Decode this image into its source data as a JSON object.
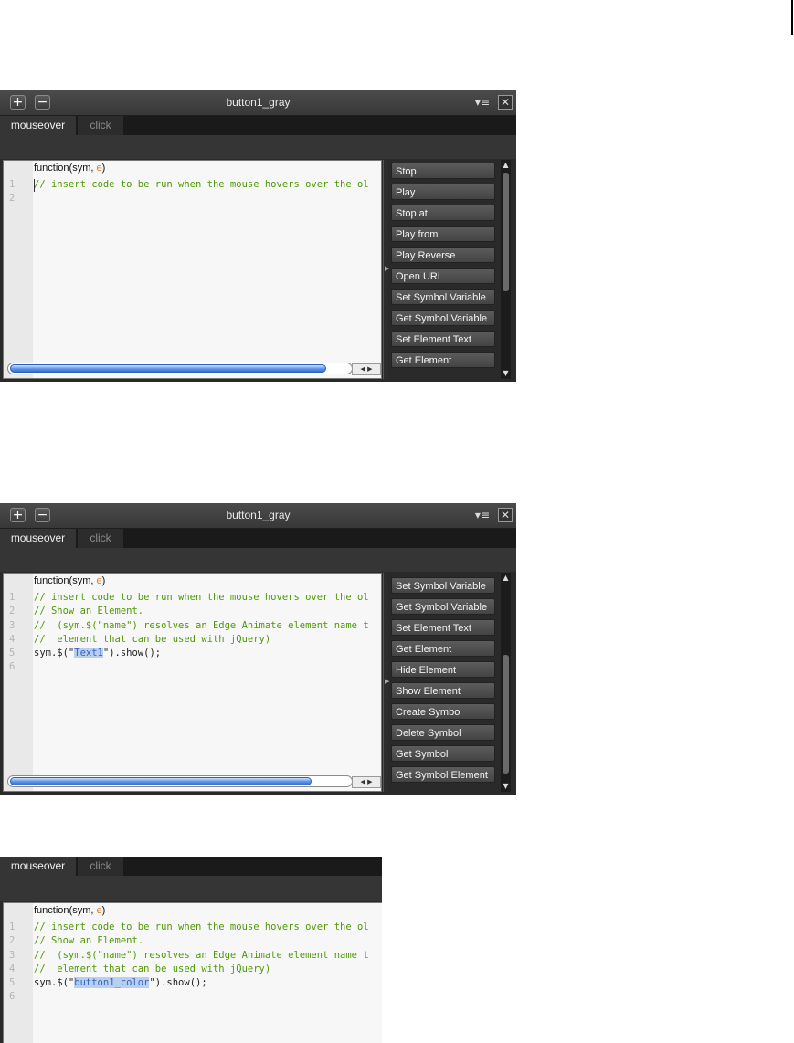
{
  "panel_title": "button1_gray",
  "icons": {
    "add": "+",
    "remove": "−",
    "menu": "▾≡",
    "close": "✕",
    "left": "◀",
    "right": "▶",
    "up": "▲",
    "down": "▼"
  },
  "tabs": {
    "active": "mouseover",
    "inactive": "click"
  },
  "function_header": {
    "text": "function(sym, ",
    "param": "e",
    "close": ")"
  },
  "panels": [
    {
      "lines": [
        {
          "num": "1",
          "parts": [
            {
              "text": "// insert code to be run when the mouse hovers over the ol",
              "style": "comment"
            }
          ]
        },
        {
          "num": "2",
          "parts": []
        }
      ],
      "snippets": [
        "Stop",
        "Play",
        "Stop at",
        "Play from",
        "Play Reverse",
        "Open URL",
        "Set Symbol Variable",
        "Get Symbol Variable",
        "Set Element Text",
        "Get Element"
      ]
    },
    {
      "lines": [
        {
          "num": "1",
          "parts": [
            {
              "text": "// insert code to be run when the mouse hovers over the ol",
              "style": "comment"
            }
          ]
        },
        {
          "num": "2",
          "parts": [
            {
              "text": "// Show an Element.",
              "style": "comment"
            }
          ]
        },
        {
          "num": "3",
          "parts": [
            {
              "text": "//  (sym.$(\"name\") resolves an Edge Animate element name t",
              "style": "comment"
            }
          ]
        },
        {
          "num": "4",
          "parts": [
            {
              "text": "//  element that can be used with jQuery)",
              "style": "comment"
            }
          ]
        },
        {
          "num": "5",
          "parts": [
            {
              "text": "sym.$(\"",
              "style": "plain"
            },
            {
              "text": "Text1",
              "style": "sel"
            },
            {
              "text": "\").show();",
              "style": "plain"
            }
          ]
        },
        {
          "num": "6",
          "parts": []
        }
      ],
      "snippets": [
        "Set Symbol Variable",
        "Get Symbol Variable",
        "Set Element Text",
        "Get Element",
        "Hide Element",
        "Show Element",
        "Create Symbol",
        "Delete Symbol",
        "Get Symbol",
        "Get Symbol Element"
      ]
    },
    {
      "lines": [
        {
          "num": "1",
          "parts": [
            {
              "text": "// insert code to be run when the mouse hovers over the ol",
              "style": "comment"
            }
          ]
        },
        {
          "num": "2",
          "parts": [
            {
              "text": "// Show an Element.",
              "style": "comment"
            }
          ]
        },
        {
          "num": "3",
          "parts": [
            {
              "text": "//  (sym.$(\"name\") resolves an Edge Animate element name t",
              "style": "comment"
            }
          ]
        },
        {
          "num": "4",
          "parts": [
            {
              "text": "//  element that can be used with jQuery)",
              "style": "comment"
            }
          ]
        },
        {
          "num": "5",
          "parts": [
            {
              "text": "sym.$(\"",
              "style": "plain"
            },
            {
              "text": "button1_color",
              "style": "sel"
            },
            {
              "text": "\").show();",
              "style": "plain"
            }
          ]
        },
        {
          "num": "6",
          "parts": []
        }
      ],
      "snippets": []
    }
  ]
}
